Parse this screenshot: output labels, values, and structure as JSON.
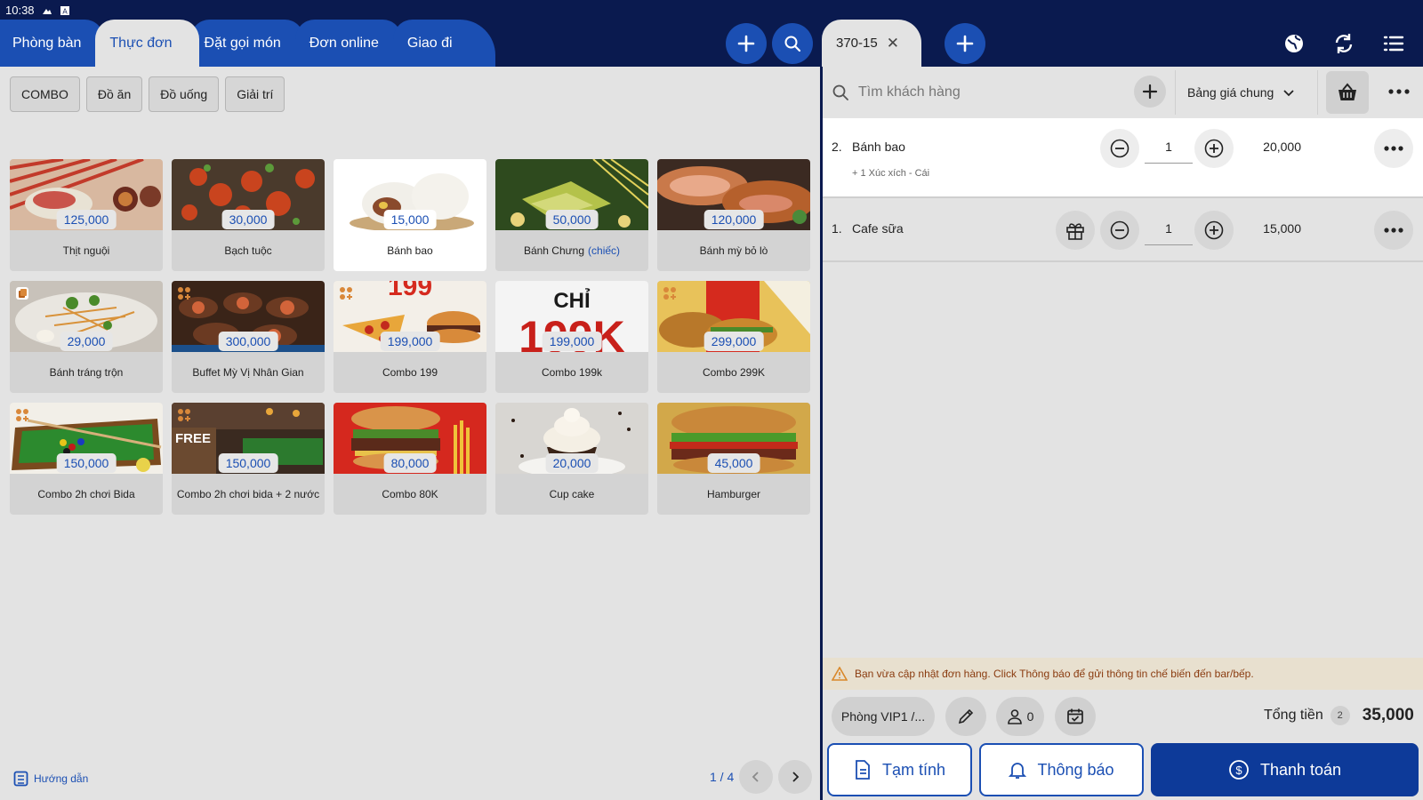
{
  "status": {
    "time": "10:38"
  },
  "tabs": [
    "Phòng bàn",
    "Thực đơn",
    "Đặt gọi món",
    "Đơn online",
    "Giao đi"
  ],
  "categories": [
    "COMBO",
    "Đồ ăn",
    "Đồ uống",
    "Giải trí"
  ],
  "products": [
    {
      "name": "Thịt nguội",
      "price": "125,000"
    },
    {
      "name": "Bạch tuộc",
      "price": "30,000"
    },
    {
      "name": "Bánh bao",
      "price": "15,000"
    },
    {
      "name": "Bánh Chưng",
      "name_sub": "(chiếc)",
      "price": "50,000"
    },
    {
      "name": "Bánh mỳ bỏ lò",
      "price": "120,000"
    },
    {
      "name": "Bánh tráng trộn",
      "price": "29,000"
    },
    {
      "name": "Buffet Mỳ Vị Nhân Gian",
      "price": "300,000"
    },
    {
      "name": "Combo 199",
      "price": "199,000"
    },
    {
      "name": "Combo 199k",
      "price": "199,000"
    },
    {
      "name": "Combo 299K",
      "price": "299,000"
    },
    {
      "name": "Combo 2h chơi Bida",
      "price": "150,000"
    },
    {
      "name": "Combo 2h chơi bida + 2 nước",
      "price": "150,000"
    },
    {
      "name": "Combo 80K",
      "price": "80,000"
    },
    {
      "name": "Cup cake",
      "price": "20,000"
    },
    {
      "name": "Hamburger",
      "price": "45,000"
    }
  ],
  "image_text": {
    "combo199": "199",
    "chi": "CHỈ",
    "k199": "199K",
    "free": "FREE"
  },
  "guide_label": "Hướng dẫn",
  "pager": {
    "label": "1 / 4"
  },
  "order": {
    "tab_label": "370-15",
    "search_placeholder": "Tìm khách hàng",
    "price_list": "Bảng giá chung",
    "lines": [
      {
        "index": "2.",
        "name": "Bánh bao",
        "modifier": "+ 1 Xúc xích - Cái",
        "qty": "1",
        "amount": "20,000"
      },
      {
        "index": "1.",
        "name": "Cafe sữa",
        "qty": "1",
        "amount": "15,000"
      }
    ],
    "notice": "Bạn vừa cập nhật đơn hàng. Click Thông báo để gửi thông tin chế biến đến bar/bếp.",
    "room": "Phòng VIP1 /...",
    "guests": "0",
    "total_label": "Tổng tiền",
    "total_count": "2",
    "total_value": "35,000",
    "btn_provisional": "Tạm tính",
    "btn_notify": "Thông báo",
    "btn_pay": "Thanh toán"
  },
  "colors": {
    "navy": "#0a1a4f",
    "blue": "#1b4fb3",
    "notice_bg": "#e8e0cf",
    "notice_text": "#8a3b0f"
  }
}
